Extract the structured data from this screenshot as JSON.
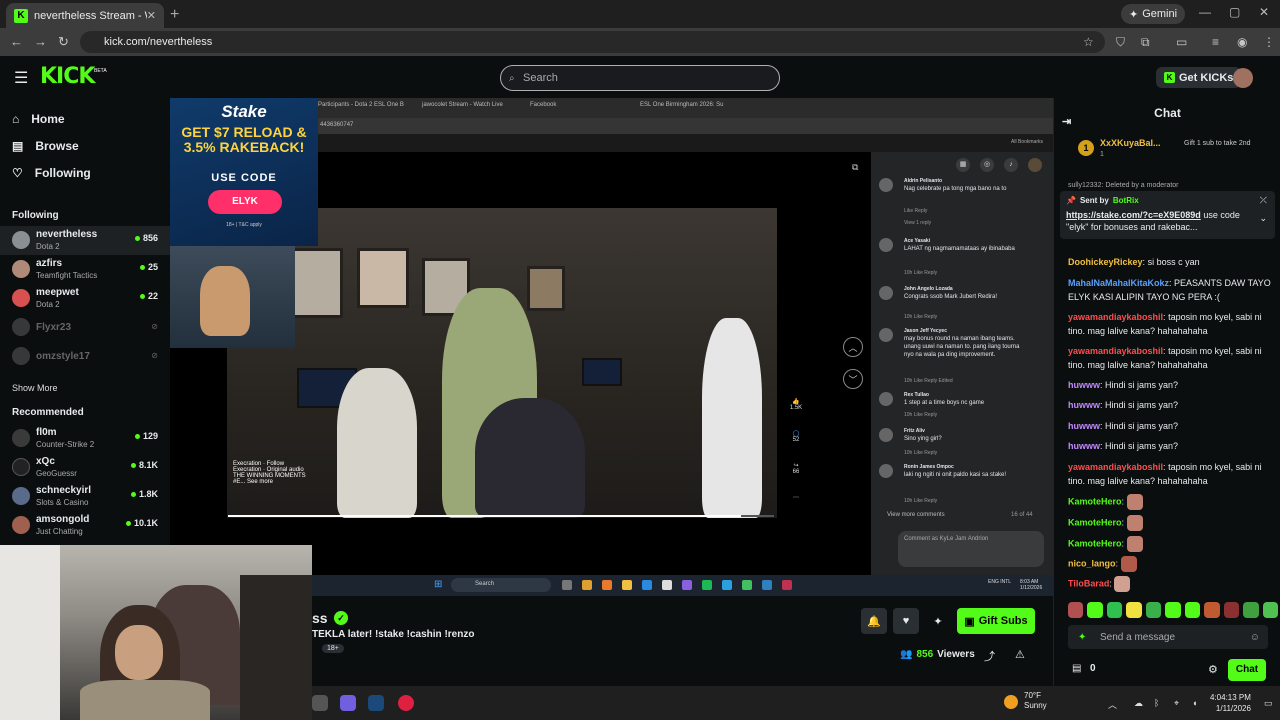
{
  "browser": {
    "tab_title": "nevertheless Stream - Watch Li",
    "new_tab": "+",
    "gemini_label": "Gemini",
    "url": "kick.com/nevertheless"
  },
  "header": {
    "logo": "KICK",
    "beta": "BETA",
    "search_placeholder": "Search",
    "get_kicks": "Get KICKs"
  },
  "sidebar": {
    "nav": [
      {
        "label": "Home",
        "icon": "home-icon"
      },
      {
        "label": "Browse",
        "icon": "browse-icon"
      },
      {
        "label": "Following",
        "icon": "heart-icon"
      }
    ],
    "following_header": "Following",
    "following": [
      {
        "name": "nevertheless",
        "game": "Dota 2",
        "viewers": "856",
        "color": "#8a8f94",
        "live": true
      },
      {
        "name": "azfirs",
        "game": "Teamfight Tactics",
        "viewers": "25",
        "color": "#b08a78",
        "live": true
      },
      {
        "name": "meepwet",
        "game": "Dota 2",
        "viewers": "22",
        "color": "#d85050",
        "live": true
      },
      {
        "name": "Flyxr23",
        "game": "",
        "viewers": "",
        "color": "#777",
        "live": false
      },
      {
        "name": "omzstyle17",
        "game": "",
        "viewers": "",
        "color": "#777",
        "live": false
      }
    ],
    "show_more": "Show More",
    "recommended_header": "Recommended",
    "recommended": [
      {
        "name": "fl0m",
        "game": "Counter-Strike 2",
        "viewers": "129",
        "color": "#3a3a3a"
      },
      {
        "name": "xQc",
        "game": "GeoGuessr",
        "viewers": "8.1K",
        "color": "#222"
      },
      {
        "name": "schneckyirl",
        "game": "Slots & Casino",
        "viewers": "1.8K",
        "color": "#5a6a8a"
      },
      {
        "name": "amsongold",
        "game": "Just Chatting",
        "viewers": "10.1K",
        "color": "#a06050"
      }
    ]
  },
  "stream_screen": {
    "inner_tabs": [
      "Participants - Dota 2 ESL One B",
      "jawocolet Stream - Watch Live",
      "Facebook",
      "ESL One Birmingham 2026: Su"
    ],
    "inner_url": "4436360747",
    "bookmarks": "All Bookmarks",
    "ad": {
      "logo": "Stake",
      "headline": "GET $7 RELOAD & 3.5% RAKEBACK!",
      "use_code": "USE CODE",
      "code": "ELYK",
      "terms": "18+ | T&C apply"
    },
    "video_info": {
      "author": "Execration",
      "follow": "Follow",
      "audio": "Execration · Original audio",
      "caption": "THE WINNING MOMENTS",
      "see_more": "#E... See more"
    },
    "actions": [
      {
        "icon": "like-icon",
        "count": "1.5K"
      },
      {
        "icon": "comment-icon",
        "count": "52"
      },
      {
        "icon": "share-icon",
        "count": "66"
      }
    ],
    "comments": [
      {
        "name": "Aldrin Pelisanto",
        "text": "Nag celebrate pa tong mga bano na to",
        "meta": "Like   Reply"
      },
      {
        "name": "",
        "text": "",
        "meta": "View 1 reply"
      },
      {
        "name": "Ace Yasaki",
        "text": "LAHAT ng nagmamamataas ay ibinababa",
        "meta": "10h   Like   Reply"
      },
      {
        "name": "John Angelo Lozada",
        "text": "Congrats ssob Mark Jubert Redira!",
        "meta": "10h   Like   Reply"
      },
      {
        "name": "Jason Jeff Yecyec",
        "text": "may bonus round na naman ibang teams. unang uuwi na naman to. pang ilang tourna nyo na wala pa ding improvement.",
        "meta": "10h   Like   Reply   Edited"
      },
      {
        "name": "Rex Tullao",
        "text": "1 step at a time boys nc game",
        "meta": "10h   Like   Reply"
      },
      {
        "name": "Fritz Aliv",
        "text": "Sino ying girl?",
        "meta": "10h   Like   Reply"
      },
      {
        "name": "Ronin James Ompoc",
        "text": "laki ng ngiti ni onit paldo kasi sa stake!",
        "meta": "10h   Like   Reply"
      }
    ],
    "view_more_comments": "View more comments",
    "comment_count": "16 of 44",
    "comment_placeholder": "Comment as KyLe Jam Andrion",
    "taskbar_search": "Search",
    "clock": "8:03 AM 1/12/2026",
    "lang": "ENG INTL"
  },
  "stream": {
    "name_partial": "ss",
    "title": "TEKLA later! !stake !cashin !renzo",
    "mature": "18+",
    "gift_subs": "Gift Subs",
    "viewers_count": "856",
    "viewers_label": "Viewers"
  },
  "chat": {
    "title": "Chat",
    "top_gifter": {
      "rank": "1",
      "name": "XxXKuyaBal...",
      "count": "1",
      "note": "Gift 1 sub to take 2nd"
    },
    "mod_msg": "sully12332: Deleted by a moderator",
    "pinned": {
      "sent_by": "Sent by",
      "bot": "BotRix",
      "link": "https://stake.com/?c=eX9E089d",
      "text": "use code \"elyk\" for bonuses and rakebac..."
    },
    "messages": [
      {
        "user": "DoohickeyRickey",
        "text": "si boss c yan",
        "color": "#f0c040"
      },
      {
        "user": "MahalNaMahalKitaKokz",
        "text": "PEASANTS DAW TAYO ELYK KASI ALIPIN TAYO NG PERA :(",
        "color": "#5aa0ff"
      },
      {
        "user": "yawamandiaykaboshil",
        "text": "taposin mo kyel, sabi ni tino. mag lalive kana? hahahahaha",
        "color": "#ff4d4d"
      },
      {
        "user": "yawamandiaykaboshil",
        "text": "taposin mo kyel, sabi ni tino. mag lalive kana? hahahahaha",
        "color": "#ff4d4d"
      },
      {
        "user": "huwww",
        "text": "Hindi si jams yan?",
        "color": "#c08aff"
      },
      {
        "user": "huwww",
        "text": "Hindi si jams yan?",
        "color": "#c08aff"
      },
      {
        "user": "huwww",
        "text": "Hindi si jams yan?",
        "color": "#c08aff"
      },
      {
        "user": "huwww",
        "text": "Hindi si jams yan?",
        "color": "#c08aff"
      },
      {
        "user": "yawamandiaykaboshil",
        "text": "taposin mo kyel, sabi ni tino. mag lalive kana? hahahahaha",
        "color": "#ff4d4d"
      },
      {
        "user": "KamoteHero",
        "text": "",
        "color": "#53fc18"
      },
      {
        "user": "KamoteHero",
        "text": "",
        "color": "#53fc18"
      },
      {
        "user": "KamoteHero",
        "text": "",
        "color": "#53fc18"
      },
      {
        "user": "nico_lango",
        "text": "",
        "color": "#f0c040"
      },
      {
        "user": "TiloBarad",
        "text": "",
        "color": "#ff4d4d"
      }
    ],
    "input_placeholder": "Send a message",
    "kicks": "0",
    "chat_button": "Chat"
  },
  "taskbar": {
    "weather_temp": "70°F",
    "weather_cond": "Sunny",
    "time": "4:04:13 PM",
    "date": "1/11/2026"
  },
  "colors": {
    "accent": "#53fc18",
    "bg": "#0b0e0f"
  }
}
